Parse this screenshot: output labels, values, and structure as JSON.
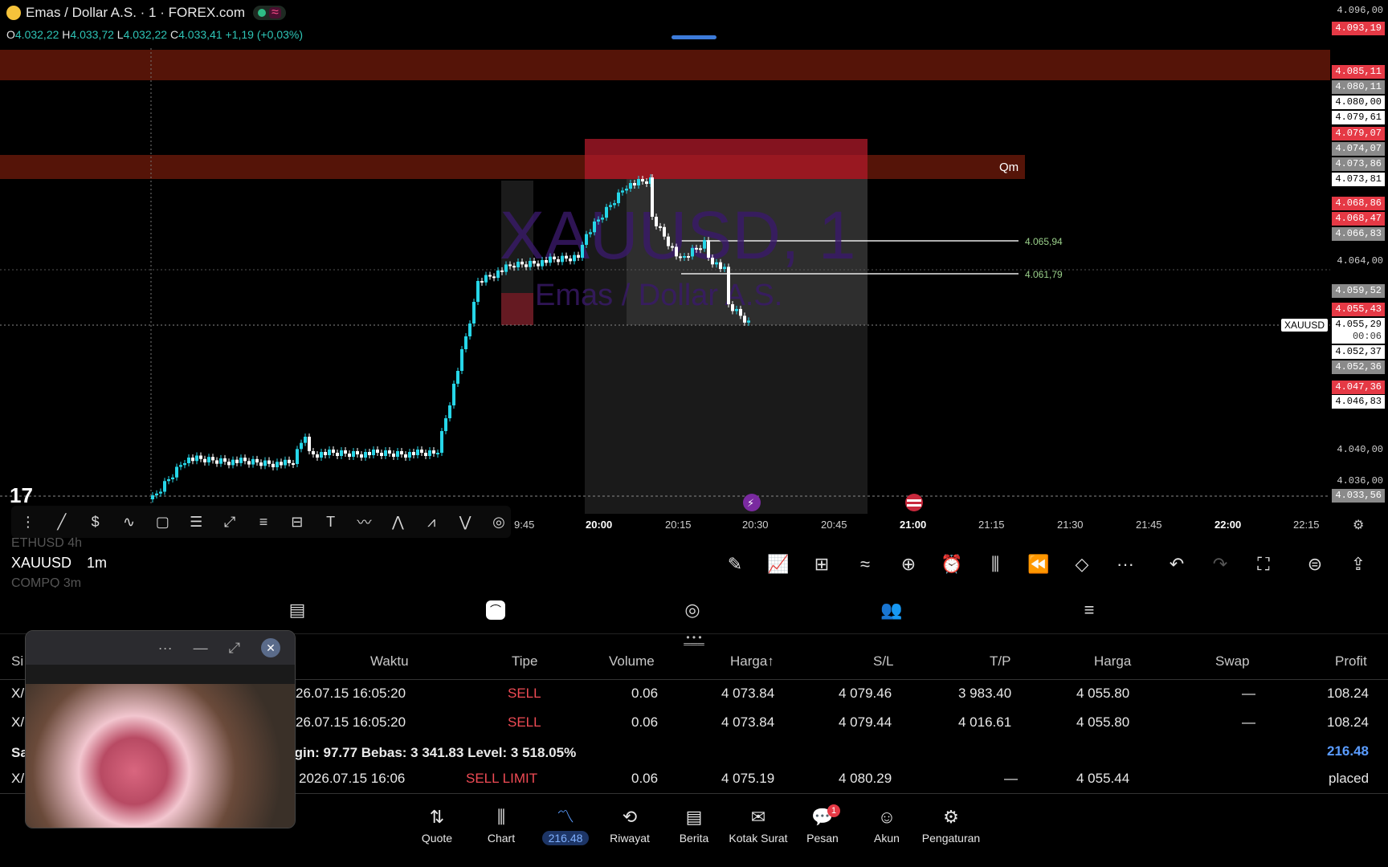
{
  "header": {
    "title": "Emas / Dollar A.S. · 1 · FOREX.com",
    "ohlc": {
      "o_label": "O",
      "o": "4.032,22",
      "h_label": "H",
      "h": "4.033,72",
      "l_label": "L",
      "l": "4.032,22",
      "c_label": "C",
      "c": "4.033,41",
      "change": "+1,19 (+0,03%)"
    }
  },
  "chart": {
    "watermark_symbol": "XAUUSD, 1",
    "watermark_name": "Emas / Dollar A.S.",
    "zone_label": "Qm",
    "hline_labels": [
      "4.065,94",
      "4.061,79"
    ],
    "symbol_tag": "XAUUSD",
    "countdown": "00:06",
    "price_ticks": [
      "4.096,00",
      "4.064,00",
      "4.040,00",
      "4.036,00"
    ],
    "price_labels": [
      {
        "text": "4.093,19",
        "style": "red"
      },
      {
        "text": "4.085,11",
        "style": "red"
      },
      {
        "text": "4.080,11",
        "style": "gray"
      },
      {
        "text": "4.080,00",
        "style": "white"
      },
      {
        "text": "4.079,61",
        "style": "white"
      },
      {
        "text": "4.079,07",
        "style": "red"
      },
      {
        "text": "4.074,07",
        "style": "gray"
      },
      {
        "text": "4.073,86",
        "style": "gray"
      },
      {
        "text": "4.073,81",
        "style": "white"
      },
      {
        "text": "4.068,86",
        "style": "red"
      },
      {
        "text": "4.068,47",
        "style": "red"
      },
      {
        "text": "4.066,83",
        "style": "gray"
      },
      {
        "text": "4.059,52",
        "style": "gray"
      },
      {
        "text": "4.055,43",
        "style": "red"
      },
      {
        "text": "4.055,29",
        "style": "white"
      },
      {
        "text": "4.052,37",
        "style": "white"
      },
      {
        "text": "4.052,36",
        "style": "gray"
      },
      {
        "text": "4.047,36",
        "style": "red"
      },
      {
        "text": "4.046,83",
        "style": "white"
      },
      {
        "text": "4.033,56",
        "style": "gray"
      }
    ],
    "time_labels": [
      {
        "text": "9:45",
        "bold": false
      },
      {
        "text": "20:00",
        "bold": true
      },
      {
        "text": "20:15",
        "bold": false
      },
      {
        "text": "20:30",
        "bold": false
      },
      {
        "text": "20:45",
        "bold": false
      },
      {
        "text": "21:00",
        "bold": true
      },
      {
        "text": "21:15",
        "bold": false
      },
      {
        "text": "21:30",
        "bold": false
      },
      {
        "text": "21:45",
        "bold": false
      },
      {
        "text": "22:00",
        "bold": true
      },
      {
        "text": "22:15",
        "bold": false
      }
    ]
  },
  "symbols": {
    "ghost_top": "ETHUSD",
    "ghost_top_tf": "4h",
    "current": "XAUUSD",
    "current_tf": "1m",
    "ghost_bottom": "COMPQ",
    "ghost_bottom_tf": "3m"
  },
  "table": {
    "headers": {
      "symbol": "Si",
      "time": "Waktu",
      "type": "Tipe",
      "volume": "Volume",
      "price": "Harga↑",
      "sl": "S/L",
      "tp": "T/P",
      "cur_price": "Harga",
      "swap": "Swap",
      "profit": "Profit"
    },
    "rows": [
      {
        "symbol": "X/",
        "time": "26.07.15 16:05:20",
        "type": "SELL",
        "volume": "0.06",
        "price": "4 073.84",
        "sl": "4 079.46",
        "tp": "3 983.40",
        "cur_price": "4 055.80",
        "swap": "—",
        "profit": "108.24"
      },
      {
        "symbol": "X/",
        "time": "26.07.15 16:05:20",
        "type": "SELL",
        "volume": "0.06",
        "price": "4 073.84",
        "sl": "4 079.44",
        "tp": "4 016.61",
        "cur_price": "4 055.80",
        "swap": "—",
        "profit": "108.24"
      }
    ],
    "summary": {
      "prefix": "Sa",
      "text": "rgin: 97.77  Bebas: 3 341.83  Level: 3 518.05%",
      "total": "216.48"
    },
    "pending": {
      "symbol": "X/",
      "time": "2026.07.15 16:06",
      "type": "SELL LIMIT",
      "volume": "0.06",
      "price": "4 075.19",
      "sl": "4 080.29",
      "tp": "—",
      "cur_price": "4 055.44",
      "status": "placed"
    }
  },
  "bottom_nav": {
    "items": [
      {
        "label": "Quote"
      },
      {
        "label": "Chart"
      },
      {
        "label": "216.48"
      },
      {
        "label": "Riwayat"
      },
      {
        "label": "Berita"
      },
      {
        "label": "Kotak Surat"
      },
      {
        "label": "Pesan",
        "badge": "1"
      },
      {
        "label": "Akun"
      },
      {
        "label": "Pengaturan"
      }
    ]
  },
  "pip": {
    "more": "···",
    "minimize": "—",
    "expand": "⤢",
    "close": "✕"
  }
}
